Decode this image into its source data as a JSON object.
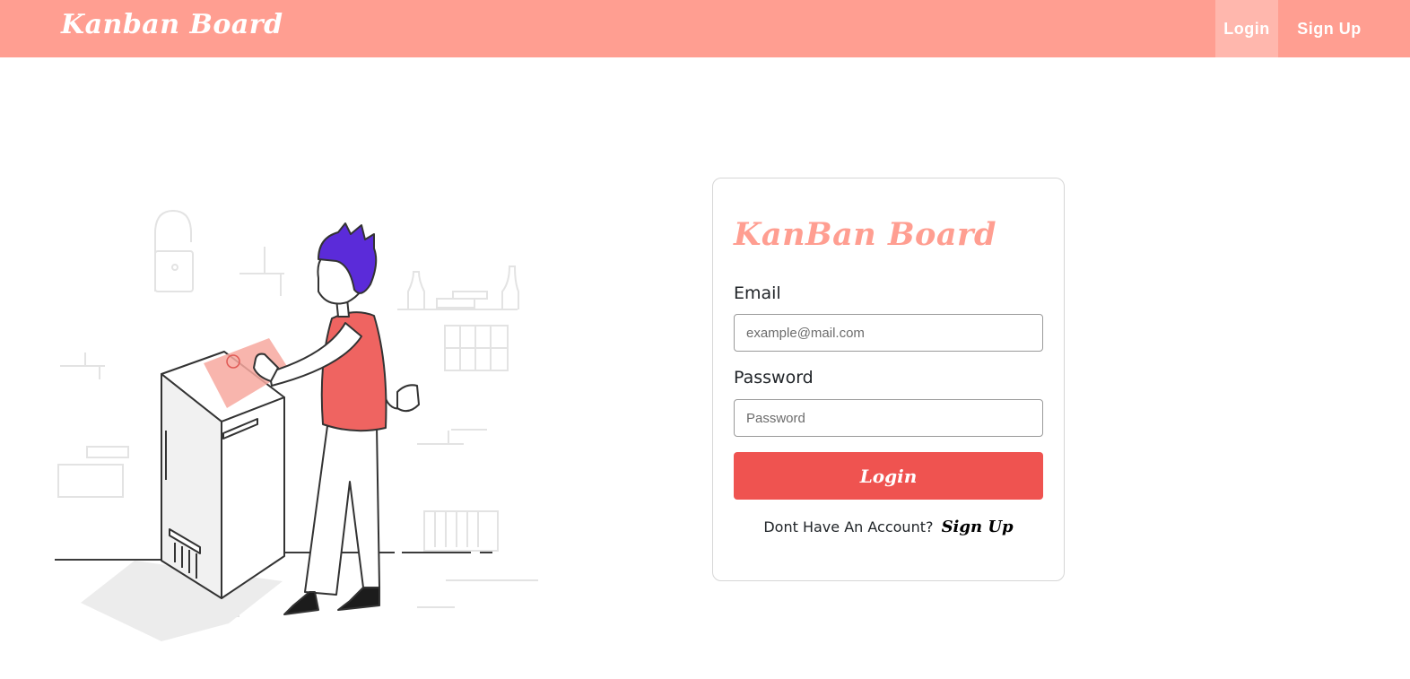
{
  "navbar": {
    "brand": "Kanban Board",
    "links": [
      {
        "label": "Login",
        "active": true
      },
      {
        "label": "Sign Up",
        "active": false
      }
    ]
  },
  "colors": {
    "navbar_bg": "#ff9e91",
    "nav_active_bg": "#ffb7ad",
    "brand_title": "#ff9e91",
    "button_bg": "#ef5350",
    "hair_purple": "#5b2bd9",
    "vest_red": "#ef6461"
  },
  "illustration": {
    "icon": "person-fingerprint-scanner-illustration"
  },
  "form": {
    "title": "KanBan Board",
    "email": {
      "label": "Email",
      "placeholder": "example@mail.com",
      "value": ""
    },
    "password": {
      "label": "Password",
      "placeholder": "Password",
      "value": ""
    },
    "submit_label": "Login",
    "signup_prompt": "Dont Have An Account?",
    "signup_link": "Sign Up"
  }
}
